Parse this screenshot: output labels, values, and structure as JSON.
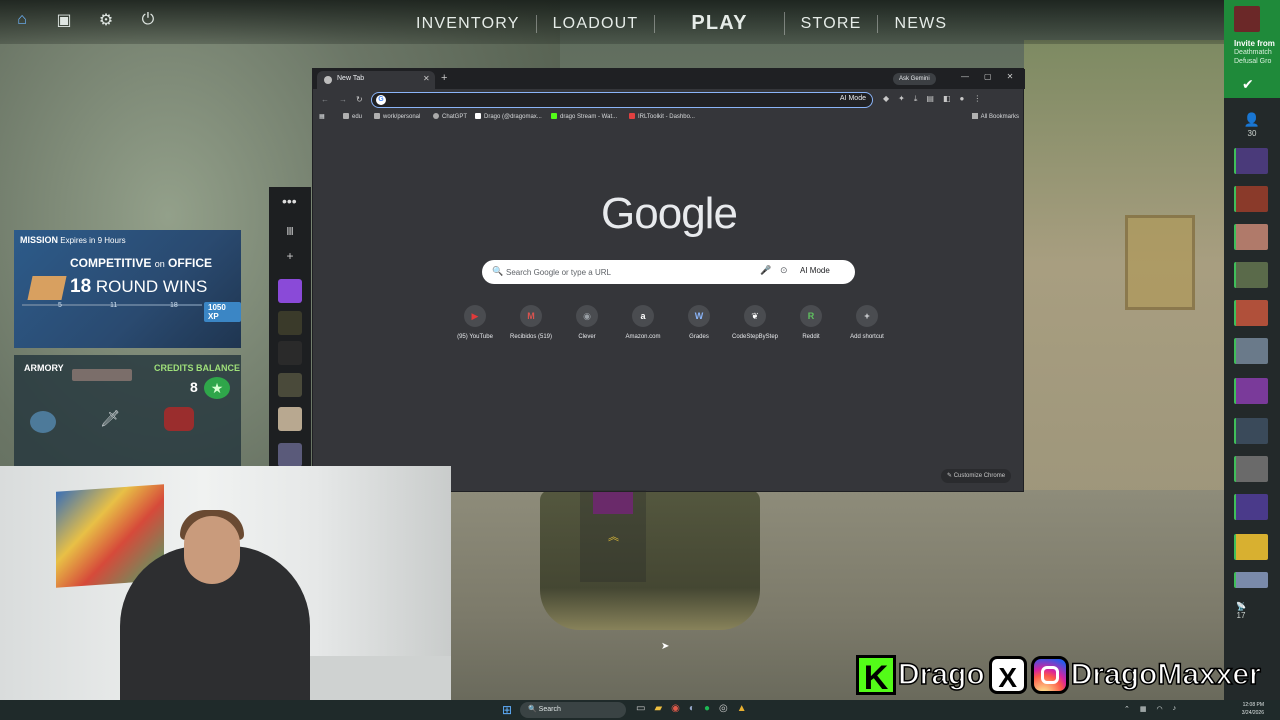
{
  "game": {
    "nav": [
      "INVENTORY",
      "LOADOUT",
      "PLAY",
      "STORE",
      "NEWS"
    ],
    "top_icons": [
      "home-icon",
      "tv-icon",
      "gear-icon",
      "power-icon"
    ],
    "mission": {
      "label": "MISSION",
      "expires": "Expires in 9 Hours",
      "mode": "COMPETITIVE",
      "on": "on",
      "map": "OFFICE",
      "count": "18",
      "goal": "ROUND WINS",
      "ticks": [
        "5",
        "11",
        "18"
      ],
      "xp": "1050 XP"
    },
    "armory": {
      "label": "ARMORY",
      "credits_label": "CREDITS BALANCE",
      "credits": "8"
    }
  },
  "social": {
    "invite_line1": "Invite from",
    "invite_line2": "Deathmatch",
    "invite_line3": "Defusal Gro",
    "friends_count": "30",
    "ping": "17"
  },
  "chrome": {
    "tab_title": "New Tab",
    "ask_gemini": "Ask Gemini",
    "omnibox_value": "",
    "ai_mode": "AI Mode",
    "bookmarks": [
      "edu",
      "work/personal",
      "ChatGPT",
      "Drago (@dragomax...",
      "drago Stream - Wat...",
      "IRLToolkit - Dashbo..."
    ],
    "all_bookmarks": "All Bookmarks",
    "logo": "Google",
    "search_placeholder": "Search Google or type a URL",
    "shortcuts": [
      {
        "label": "(95) YouTube",
        "icon": "▶",
        "color": "#e03a3a"
      },
      {
        "label": "Recibidos (519)",
        "icon": "M",
        "color": "#d9534f"
      },
      {
        "label": "Clever",
        "icon": "◉",
        "color": "#9aa0a6"
      },
      {
        "label": "Amazon.com",
        "icon": "a",
        "color": "#ffffff"
      },
      {
        "label": "Grades",
        "icon": "W",
        "color": "#8ab4f8"
      },
      {
        "label": "CodeStepByStep",
        "icon": "❦",
        "color": "#ffffff"
      },
      {
        "label": "Reddit",
        "icon": "R",
        "color": "#5fc15f"
      },
      {
        "label": "Add shortcut",
        "icon": "+",
        "color": "#e8eaed"
      }
    ],
    "customize": "Customize Chrome"
  },
  "taskbar": {
    "search": "Search",
    "time": "12:08 PM",
    "date": "3/24/2026"
  },
  "overlay": {
    "kick_name": "Drago",
    "k": "K",
    "x": "X",
    "ig_name": "DragoMaxxer"
  }
}
